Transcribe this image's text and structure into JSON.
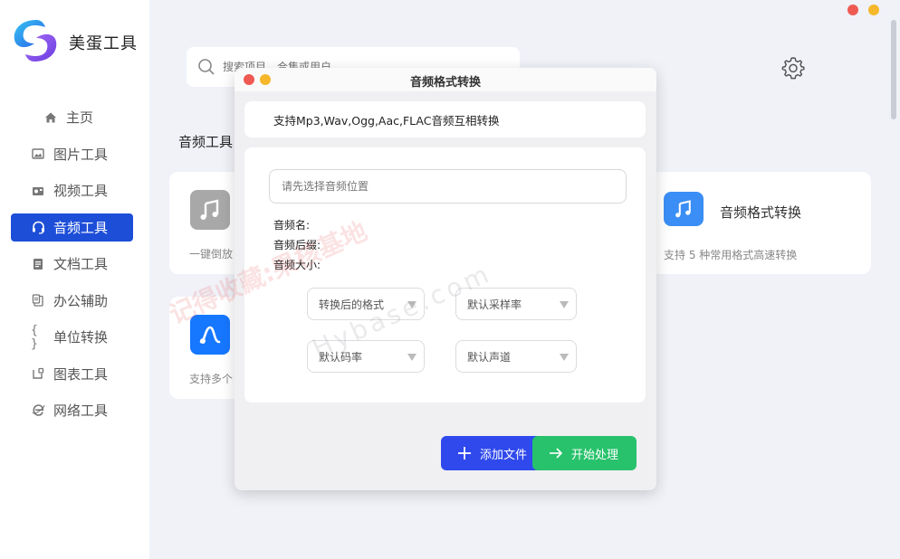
{
  "app": {
    "title": "美蛋工具"
  },
  "sidebar": {
    "items": [
      {
        "label": "主页",
        "icon": "home-icon"
      },
      {
        "label": "图片工具",
        "icon": "image-icon"
      },
      {
        "label": "视频工具",
        "icon": "video-icon"
      },
      {
        "label": "音频工具",
        "icon": "headset-icon",
        "active": true
      },
      {
        "label": "文档工具",
        "icon": "document-icon"
      },
      {
        "label": "办公辅助",
        "icon": "clipboard-icon"
      },
      {
        "label": "单位转换",
        "icon": "braces-icon"
      },
      {
        "label": "图表工具",
        "icon": "chart-icon"
      },
      {
        "label": "网络工具",
        "icon": "browser-icon"
      }
    ]
  },
  "search": {
    "placeholder": "搜索项目、合集或用户"
  },
  "main": {
    "section_title": "音频工具",
    "card_left1_desc": "一键倒放",
    "card_left2_desc": "支持多个",
    "card_right": {
      "title": "音频格式转换",
      "desc": "支持 5 种常用格式高速转换"
    }
  },
  "dialog": {
    "title": "音频格式转换",
    "support_text": "支持Mp3,Wav,Ogg,Aac,FLAC音频互相转换",
    "path_placeholder": "请先选择音频位置",
    "info": {
      "name_label": "音频名:",
      "suffix_label": "音频后缀:",
      "size_label": "音频大小:"
    },
    "selects": {
      "format": "转换后的格式",
      "sample_rate": "默认采样率",
      "bitrate": "默认码率",
      "channel": "默认声道"
    },
    "add_button": "添加文件",
    "start_button": "开始处理"
  },
  "watermark": {
    "text": "记得收藏:果核基地",
    "url": "Hybase.com"
  },
  "colors": {
    "accent": "#1d4ed8",
    "add_button": "#2f49ec",
    "start_button": "#27c26b",
    "close_dot": "#ee5a52",
    "min_dot": "#f6b72b"
  }
}
